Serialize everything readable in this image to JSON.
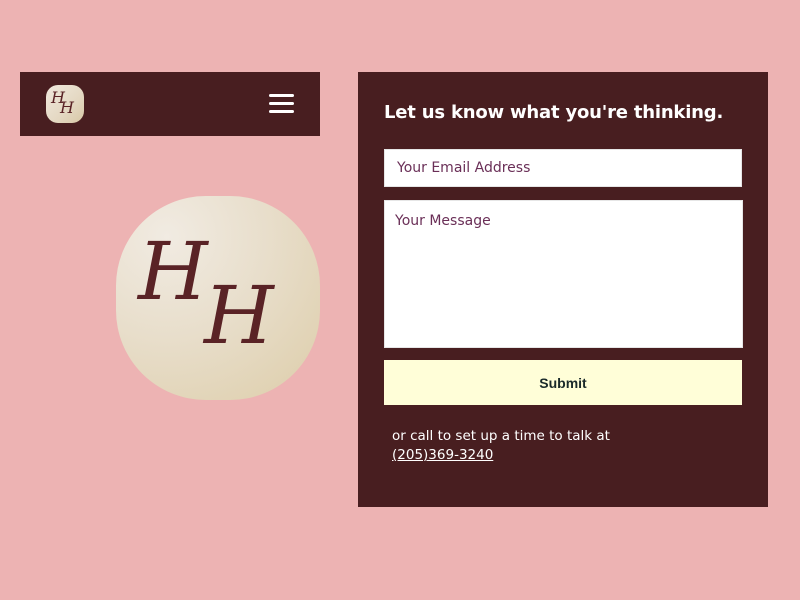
{
  "header": {
    "logo_small": {
      "letter_1": "H",
      "letter_2": "H"
    },
    "menu_icon": "hamburger-menu-icon"
  },
  "hero_logo": {
    "letter_1": "H",
    "letter_2": "H"
  },
  "contact": {
    "heading": "Let us know what you're thinking.",
    "email_placeholder": "Your Email Address",
    "email_value": "",
    "message_placeholder": "Your Message",
    "message_value": "",
    "submit_label": "Submit",
    "call_text": "or call to set up a time to talk at",
    "phone": "(205)369-3240"
  },
  "colors": {
    "page_background": "#EDB3B3",
    "panel_background": "#481E20",
    "logo_letters": "#5A2326",
    "placeholder_text": "#6A2F57",
    "submit_background": "#FFFED8"
  }
}
